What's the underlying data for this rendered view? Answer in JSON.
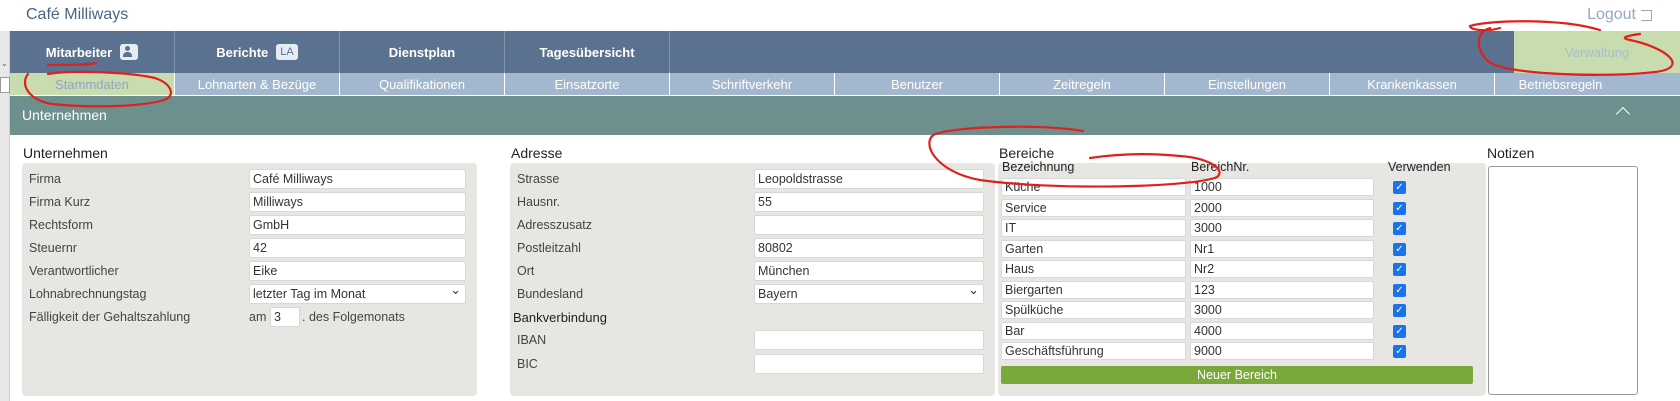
{
  "app": {
    "title": "Café Milliways",
    "logout_label": "Logout"
  },
  "nav": {
    "main": [
      {
        "label": "Mitarbeiter",
        "icon": "user-plus-icon"
      },
      {
        "label": "Berichte",
        "badge": "LA"
      },
      {
        "label": "Dienstplan"
      },
      {
        "label": "Tagesübersicht"
      }
    ],
    "admin_label": "Verwaltung",
    "sub": [
      "Stammdaten",
      "Lohnarten & Bezüge",
      "Qualifikationen",
      "Einsatzorte",
      "Schriftverkehr",
      "Benutzer",
      "Zeitregeln",
      "Einstellungen",
      "Krankenkassen",
      "Betriebsregeln"
    ]
  },
  "section": {
    "title": "Unternehmen"
  },
  "unternehmen": {
    "title": "Unternehmen",
    "fields": [
      {
        "label": "Firma",
        "value": "Café Milliways"
      },
      {
        "label": "Firma Kurz",
        "value": "Milliways"
      },
      {
        "label": "Rechtsform",
        "value": "GmbH"
      },
      {
        "label": "Steuernr",
        "value": "42"
      },
      {
        "label": "Verantwortlicher",
        "value": "Eike"
      },
      {
        "label": "Lohnabrechnungstag",
        "value": "letzter Tag im Monat",
        "type": "select"
      }
    ],
    "faelligkeit": {
      "label": "Fälligkeit der Gehaltszahlung",
      "prefix": "am",
      "value": "3",
      "suffix": ". des Folgemonats"
    }
  },
  "adresse": {
    "title": "Adresse",
    "fields": [
      {
        "label": "Strasse",
        "value": "Leopoldstrasse"
      },
      {
        "label": "Hausnr.",
        "value": "55"
      },
      {
        "label": "Adresszusatz",
        "value": ""
      },
      {
        "label": "Postleitzahl",
        "value": "80802"
      },
      {
        "label": "Ort",
        "value": "München"
      },
      {
        "label": "Bundesland",
        "value": "Bayern",
        "type": "select"
      }
    ],
    "bank_title": "Bankverbindung",
    "bank_fields": [
      {
        "label": "IBAN",
        "value": ""
      },
      {
        "label": "BIC",
        "value": ""
      }
    ]
  },
  "bereiche": {
    "title": "Bereiche",
    "headers": {
      "name": "Bezeichnung",
      "nr": "BereichNr.",
      "use": "Verwenden"
    },
    "rows": [
      {
        "name": "Küche",
        "nr": "1000",
        "checked": true
      },
      {
        "name": "Service",
        "nr": "2000",
        "checked": true
      },
      {
        "name": "IT",
        "nr": "3000",
        "checked": true
      },
      {
        "name": "Garten",
        "nr": "Nr1",
        "checked": true
      },
      {
        "name": "Haus",
        "nr": "Nr2",
        "checked": true
      },
      {
        "name": "Biergarten",
        "nr": "123",
        "checked": true
      },
      {
        "name": "Spülküche",
        "nr": "3000",
        "checked": true
      },
      {
        "name": "Bar",
        "nr": "4000",
        "checked": true
      },
      {
        "name": "Geschäftsführung",
        "nr": "9000",
        "checked": true
      }
    ],
    "new_button": "Neuer Bereich"
  },
  "notizen": {
    "title": "Notizen",
    "value": ""
  },
  "colors": {
    "nav": "#5a7290",
    "subnav": "#a3b8cf",
    "active": "#c9dcb0",
    "section": "#6d8f8d",
    "button": "#7aa83a",
    "annotation": "#e0201b"
  }
}
